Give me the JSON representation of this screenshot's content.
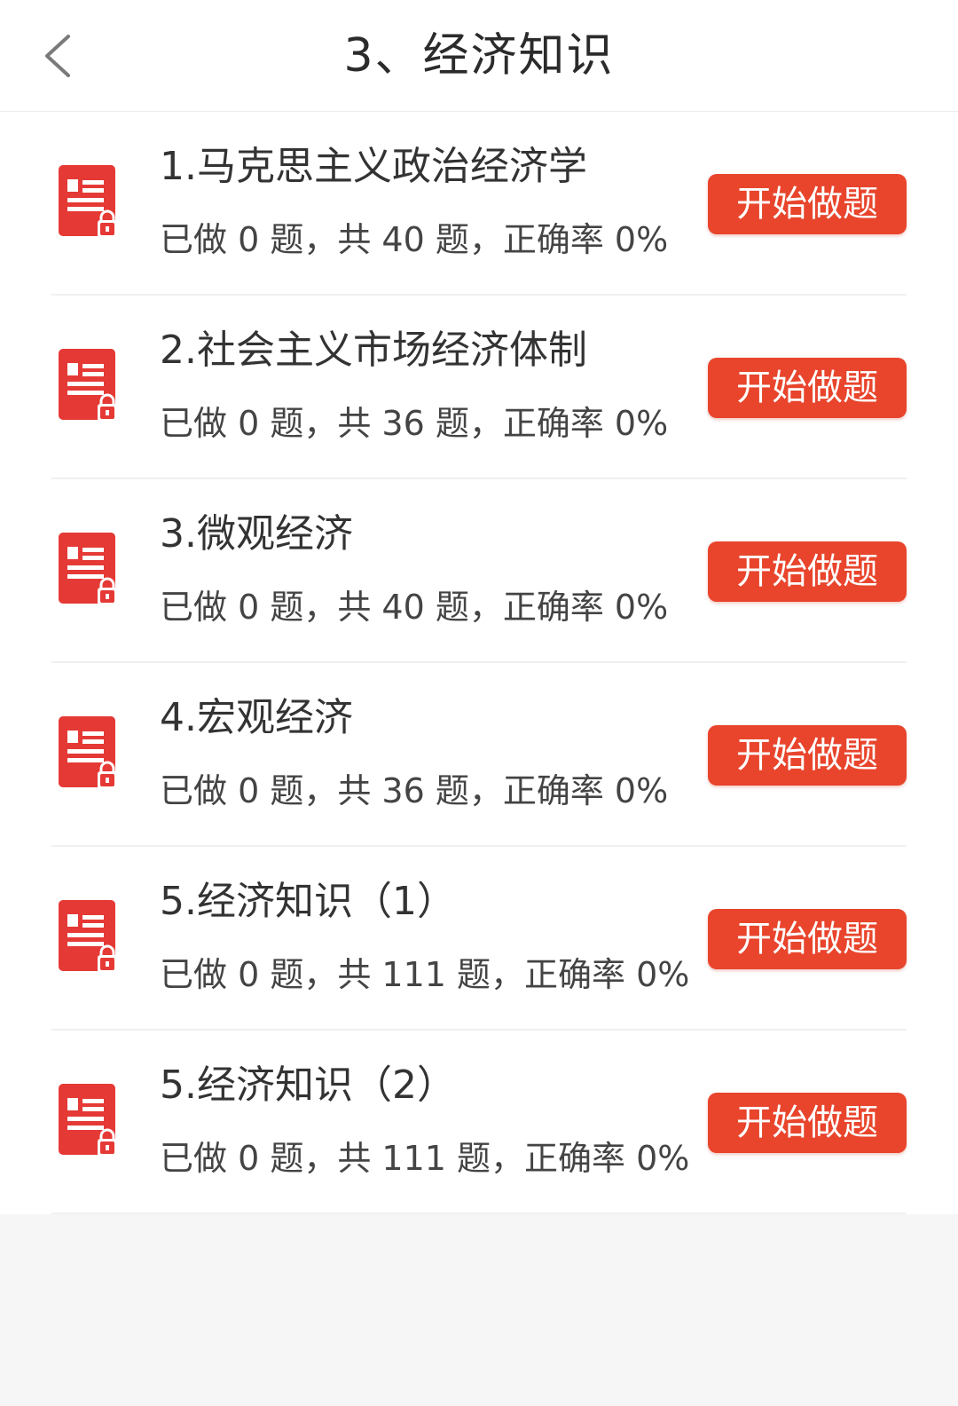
{
  "header": {
    "title": "3、经济知识",
    "back_icon": "chevron-left-icon"
  },
  "colors": {
    "accent": "#e8452c",
    "icon_red": "#e53935",
    "background": "#f6f6f6",
    "text": "#333333"
  },
  "list": {
    "items": [
      {
        "title": "1.马克思主义政治经济学",
        "stats": "已做 0 题，共 40 题，正确率 0%",
        "button": "开始做题"
      },
      {
        "title": "2.社会主义市场经济体制",
        "stats": "已做 0 题，共 36 题，正确率 0%",
        "button": "开始做题"
      },
      {
        "title": "3.微观经济",
        "stats": "已做 0 题，共 40 题，正确率 0%",
        "button": "开始做题"
      },
      {
        "title": "4.宏观经济",
        "stats": "已做 0 题，共 36 题，正确率 0%",
        "button": "开始做题"
      },
      {
        "title": "5.经济知识（1）",
        "stats": "已做 0 题，共 111 题，正确率 0%",
        "button": "开始做题"
      },
      {
        "title": "5.经济知识（2）",
        "stats": "已做 0 题，共 111 题，正确率 0%",
        "button": "开始做题"
      }
    ]
  }
}
